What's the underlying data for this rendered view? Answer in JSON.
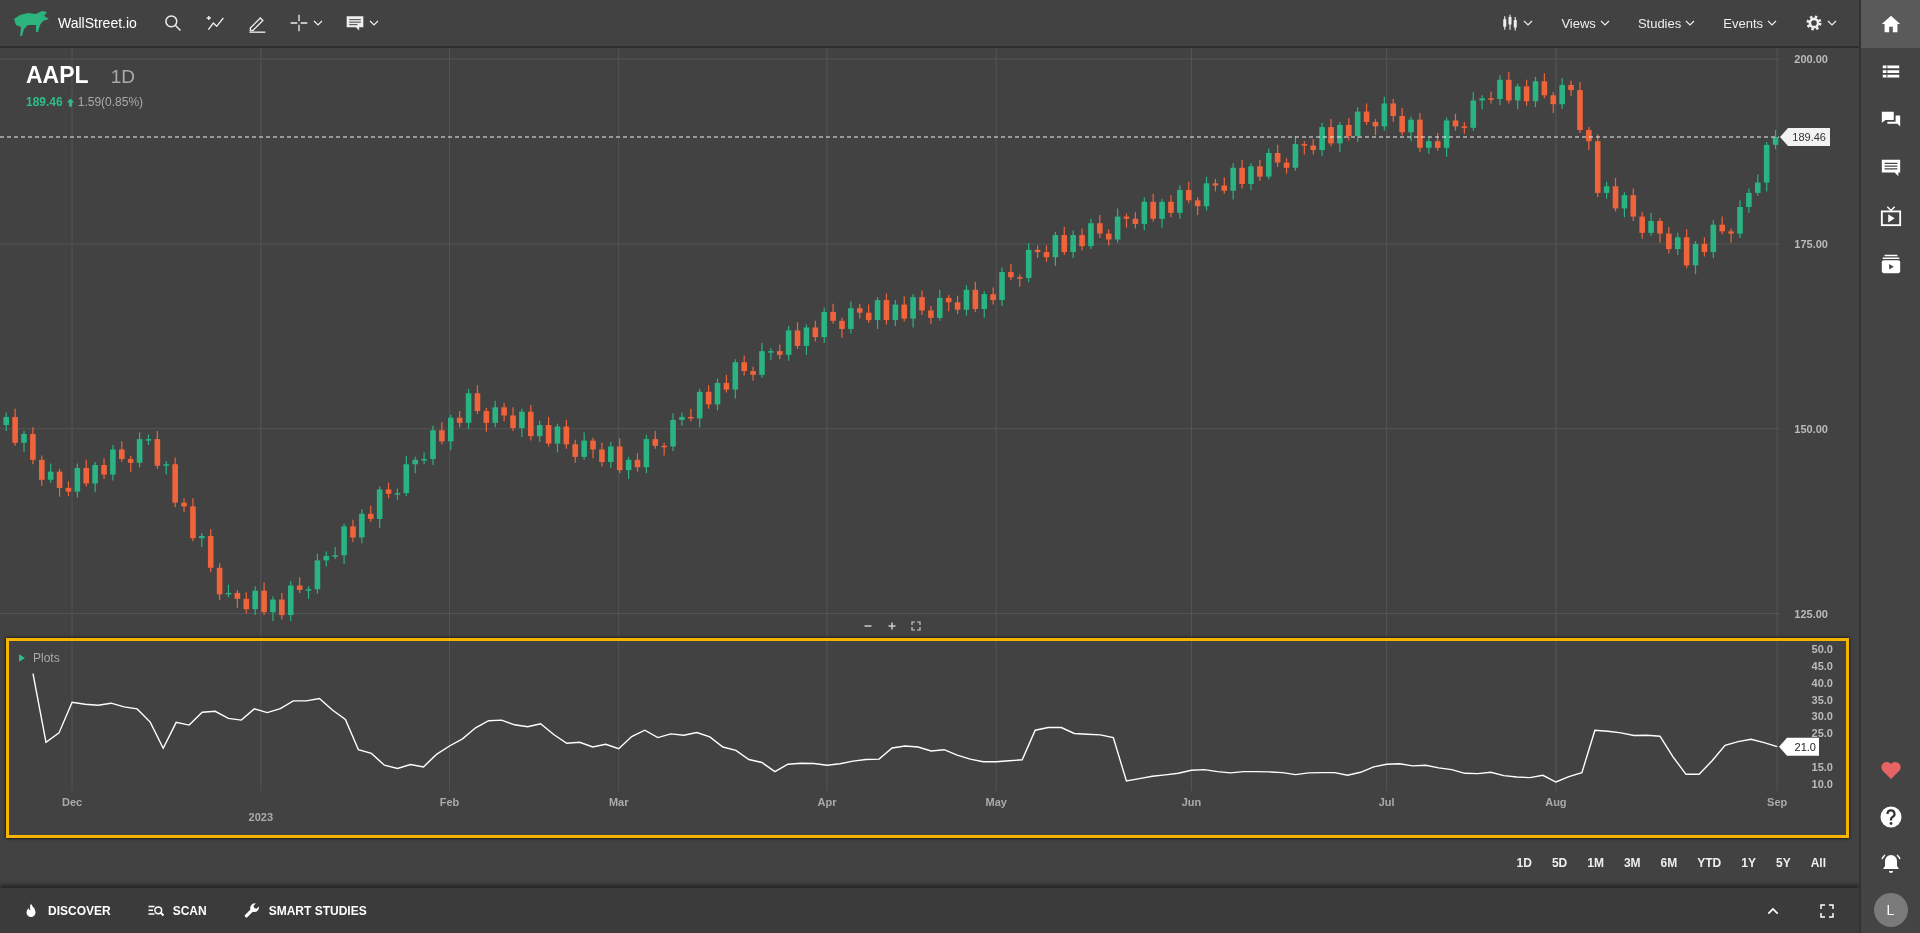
{
  "toolbar": {
    "brand": "WallStreet.io",
    "tools": [
      {
        "kind": "search",
        "menu": false
      },
      {
        "kind": "trend",
        "menu": false
      },
      {
        "kind": "draw",
        "menu": false
      },
      {
        "kind": "crosshair",
        "menu": true
      },
      {
        "kind": "comment",
        "menu": true
      }
    ],
    "right_items": [
      {
        "kind": "chart-type"
      },
      {
        "kind": "menu",
        "label": "Views"
      },
      {
        "kind": "menu",
        "label": "Studies"
      },
      {
        "kind": "menu",
        "label": "Events"
      },
      {
        "kind": "settings"
      }
    ]
  },
  "symbol": {
    "ticker": "AAPL",
    "interval": "1D",
    "price": "189.46",
    "change": "1.59(0.85%)"
  },
  "price_chart": {
    "last_price": "189.46",
    "chart_data": {
      "type": "candlestick",
      "grid": true,
      "ylim": [
        121.7,
        201.5
      ],
      "yticks": [
        {
          "value": 200,
          "label": "200.00"
        },
        {
          "value": 175,
          "label": "175.00"
        },
        {
          "value": 150,
          "label": "150.00"
        },
        {
          "value": 125,
          "label": "125.00"
        }
      ],
      "categories": [
        null,
        null,
        null,
        null,
        null,
        null,
        null,
        null,
        null,
        null,
        null,
        null,
        null,
        null,
        null,
        null,
        null,
        null,
        null,
        null,
        null,
        null,
        null,
        null,
        null,
        null,
        null,
        null,
        null,
        null,
        null,
        null,
        null,
        null,
        null,
        null,
        null,
        null,
        null,
        null,
        null,
        null,
        null,
        null,
        null,
        null,
        null,
        null,
        null,
        null,
        null,
        null,
        null,
        null,
        null,
        null,
        null,
        null,
        null,
        null,
        null,
        null,
        null,
        null,
        null,
        null,
        null,
        null,
        null,
        null,
        null,
        null,
        null,
        null,
        null,
        null,
        null,
        null,
        null,
        null,
        null,
        null,
        null,
        null,
        null,
        null,
        null,
        null,
        null,
        null,
        null,
        null,
        null,
        null,
        null,
        null,
        null,
        null,
        null,
        null,
        null,
        null,
        null,
        null,
        null,
        null,
        null,
        null,
        null,
        null,
        null,
        null,
        null,
        null,
        null,
        null,
        null,
        null,
        null,
        null,
        null,
        null,
        null,
        null,
        null,
        null,
        null,
        null,
        null,
        null,
        null,
        null,
        null,
        null,
        null,
        null,
        null,
        null,
        null,
        null,
        null,
        null,
        null,
        null,
        null,
        null,
        null,
        null,
        null,
        null,
        null,
        null,
        null,
        null,
        null,
        null,
        null,
        null,
        null,
        null,
        null,
        null,
        null,
        null,
        null,
        null,
        null,
        null,
        null,
        null,
        null,
        null,
        null,
        null,
        null,
        null,
        null,
        null,
        null,
        null,
        null,
        null,
        null,
        null,
        null,
        null,
        null,
        null,
        null,
        null,
        null,
        null,
        null,
        null,
        null,
        null,
        null,
        null,
        null,
        null
      ],
      "ohlc": [
        [
          150.5,
          152.2,
          149.7,
          151.6
        ],
        [
          151.6,
          152.7,
          147.7,
          148.1
        ],
        [
          148.1,
          149.7,
          146.9,
          149.3
        ],
        [
          149.3,
          150.2,
          145.2,
          145.8
        ],
        [
          145.8,
          146.4,
          142.3,
          143.1
        ],
        [
          143.1,
          145.3,
          142.7,
          144.2
        ],
        [
          144.2,
          144.6,
          140.8,
          142.0
        ],
        [
          142.0,
          142.9,
          140.9,
          141.5
        ],
        [
          141.5,
          145.3,
          140.7,
          144.7
        ],
        [
          144.7,
          145.8,
          142.2,
          142.6
        ],
        [
          142.6,
          145.5,
          141.4,
          145.1
        ],
        [
          145.1,
          146.0,
          143.2,
          143.8
        ],
        [
          143.8,
          147.8,
          143.0,
          147.2
        ],
        [
          147.2,
          148.3,
          145.5,
          145.9
        ],
        [
          145.9,
          146.3,
          144.2,
          145.4
        ],
        [
          145.4,
          149.5,
          144.8,
          148.6
        ],
        [
          148.6,
          149.2,
          147.8,
          148.6
        ],
        [
          148.6,
          149.7,
          144.6,
          145.0
        ],
        [
          145.0,
          145.6,
          143.8,
          145.2
        ],
        [
          145.2,
          146.1,
          139.4,
          140.0
        ],
        [
          140.0,
          140.6,
          138.7,
          139.5
        ],
        [
          139.5,
          140.6,
          134.8,
          135.2
        ],
        [
          135.2,
          135.9,
          134.0,
          135.5
        ],
        [
          135.5,
          136.4,
          130.6,
          131.2
        ],
        [
          131.2,
          131.8,
          126.8,
          127.6
        ],
        [
          127.6,
          128.9,
          127.2,
          127.8
        ],
        [
          127.8,
          128.2,
          125.8,
          127.0
        ],
        [
          127.0,
          127.9,
          125.0,
          125.6
        ],
        [
          125.6,
          128.7,
          124.8,
          128.1
        ],
        [
          128.1,
          129.2,
          124.8,
          125.2
        ],
        [
          125.2,
          127.3,
          124.0,
          126.9
        ],
        [
          126.9,
          127.8,
          124.2,
          124.8
        ],
        [
          124.8,
          129.4,
          124.0,
          128.8
        ],
        [
          128.8,
          129.9,
          127.8,
          128.2
        ],
        [
          128.2,
          128.7,
          127.0,
          128.3
        ],
        [
          128.3,
          133.1,
          127.7,
          132.2
        ],
        [
          132.2,
          133.4,
          131.4,
          132.8
        ],
        [
          132.8,
          134.0,
          132.4,
          132.9
        ],
        [
          132.9,
          137.2,
          131.7,
          136.8
        ],
        [
          136.8,
          137.7,
          134.7,
          135.3
        ],
        [
          135.3,
          139.1,
          134.5,
          138.5
        ],
        [
          138.5,
          139.6,
          137.4,
          137.8
        ],
        [
          137.8,
          142.2,
          136.6,
          141.8
        ],
        [
          141.8,
          142.7,
          140.6,
          141.2
        ],
        [
          141.2,
          141.9,
          140.4,
          141.3
        ],
        [
          141.3,
          146.3,
          140.9,
          145.2
        ],
        [
          145.2,
          146.2,
          144.0,
          145.8
        ],
        [
          145.8,
          146.8,
          145.2,
          145.9
        ],
        [
          145.9,
          150.4,
          145.1,
          149.8
        ],
        [
          149.8,
          150.9,
          147.9,
          148.3
        ],
        [
          148.3,
          151.9,
          147.1,
          151.5
        ],
        [
          151.5,
          152.4,
          150.2,
          150.8
        ],
        [
          150.8,
          155.4,
          150.0,
          154.8
        ],
        [
          154.8,
          155.9,
          152.0,
          152.4
        ],
        [
          152.4,
          152.8,
          149.6,
          150.8
        ],
        [
          150.8,
          153.8,
          150.2,
          152.9
        ],
        [
          152.9,
          153.5,
          151.0,
          151.8
        ],
        [
          151.8,
          152.9,
          149.7,
          150.1
        ],
        [
          150.1,
          152.7,
          148.9,
          152.3
        ],
        [
          152.3,
          153.2,
          148.4,
          149.0
        ],
        [
          149.0,
          151.1,
          148.2,
          150.5
        ],
        [
          150.5,
          151.6,
          147.6,
          148.0
        ],
        [
          148.0,
          150.7,
          146.8,
          150.3
        ],
        [
          150.3,
          151.2,
          147.3,
          147.9
        ],
        [
          147.9,
          148.5,
          145.4,
          146.2
        ],
        [
          146.2,
          149.5,
          145.8,
          148.4
        ],
        [
          148.4,
          148.8,
          146.0,
          147.2
        ],
        [
          147.2,
          148.1,
          144.9,
          145.5
        ],
        [
          145.5,
          148.2,
          144.7,
          147.6
        ],
        [
          147.6,
          148.7,
          144.0,
          144.4
        ],
        [
          144.4,
          146.2,
          143.2,
          145.8
        ],
        [
          145.8,
          146.7,
          144.2,
          144.8
        ],
        [
          144.8,
          149.2,
          144.0,
          148.6
        ],
        [
          148.6,
          149.7,
          147.3,
          147.7
        ],
        [
          147.7,
          148.1,
          146.4,
          147.6
        ],
        [
          147.6,
          152.1,
          147.0,
          151.2
        ],
        [
          151.2,
          152.2,
          150.4,
          151.6
        ],
        [
          151.6,
          152.7,
          151.0,
          151.4
        ],
        [
          151.4,
          155.4,
          150.2,
          155.0
        ],
        [
          155.0,
          155.9,
          152.7,
          153.3
        ],
        [
          153.3,
          156.8,
          152.5,
          156.2
        ],
        [
          156.2,
          157.3,
          154.9,
          155.3
        ],
        [
          155.3,
          159.4,
          154.1,
          159.0
        ],
        [
          159.0,
          159.9,
          157.2,
          157.8
        ],
        [
          157.8,
          158.4,
          156.5,
          157.3
        ],
        [
          157.3,
          161.6,
          156.9,
          160.5
        ],
        [
          160.5,
          160.9,
          159.3,
          160.5
        ],
        [
          160.5,
          161.4,
          159.4,
          160.0
        ],
        [
          160.0,
          163.9,
          159.2,
          163.3
        ],
        [
          163.3,
          164.4,
          160.8,
          161.2
        ],
        [
          161.2,
          164.1,
          160.0,
          163.7
        ],
        [
          163.7,
          164.6,
          161.8,
          162.4
        ],
        [
          162.4,
          166.4,
          161.6,
          165.8
        ],
        [
          165.8,
          166.9,
          164.2,
          164.6
        ],
        [
          164.6,
          165.0,
          162.3,
          163.5
        ],
        [
          163.5,
          167.2,
          162.9,
          166.3
        ],
        [
          166.3,
          166.9,
          164.9,
          165.7
        ],
        [
          165.7,
          166.8,
          164.3,
          164.7
        ],
        [
          164.7,
          167.8,
          163.5,
          167.4
        ],
        [
          167.4,
          168.3,
          164.1,
          164.7
        ],
        [
          164.7,
          167.4,
          163.9,
          166.8
        ],
        [
          166.8,
          167.9,
          164.5,
          164.9
        ],
        [
          164.9,
          168.2,
          163.7,
          167.8
        ],
        [
          167.8,
          168.7,
          165.4,
          166.0
        ],
        [
          166.0,
          166.6,
          164.2,
          165.0
        ],
        [
          165.0,
          168.8,
          164.6,
          167.7
        ],
        [
          167.7,
          168.1,
          165.9,
          167.1
        ],
        [
          167.1,
          168.0,
          165.5,
          166.1
        ],
        [
          166.1,
          169.4,
          165.3,
          168.8
        ],
        [
          168.8,
          169.9,
          165.8,
          166.2
        ],
        [
          166.2,
          168.6,
          165.0,
          168.2
        ],
        [
          168.2,
          169.1,
          166.8,
          167.4
        ],
        [
          167.4,
          171.8,
          166.6,
          171.2
        ],
        [
          171.2,
          172.3,
          170.1,
          170.5
        ],
        [
          170.5,
          170.9,
          169.2,
          170.4
        ],
        [
          170.4,
          175.1,
          169.8,
          174.2
        ],
        [
          174.2,
          174.8,
          173.1,
          173.9
        ],
        [
          173.9,
          174.8,
          172.6,
          173.2
        ],
        [
          173.2,
          176.6,
          172.0,
          176.2
        ],
        [
          176.2,
          177.3,
          173.5,
          173.9
        ],
        [
          173.9,
          176.8,
          173.1,
          176.2
        ],
        [
          176.2,
          177.1,
          174.1,
          174.7
        ],
        [
          174.7,
          178.4,
          174.3,
          177.8
        ],
        [
          177.8,
          178.9,
          175.8,
          176.4
        ],
        [
          176.4,
          177.0,
          174.8,
          175.6
        ],
        [
          175.6,
          179.8,
          175.2,
          178.7
        ],
        [
          178.7,
          179.1,
          177.2,
          178.4
        ],
        [
          178.4,
          179.3,
          177.1,
          177.7
        ],
        [
          177.7,
          181.3,
          176.9,
          180.7
        ],
        [
          180.7,
          181.8,
          178.0,
          178.4
        ],
        [
          178.4,
          181.1,
          177.2,
          180.7
        ],
        [
          180.7,
          181.6,
          178.6,
          179.2
        ],
        [
          179.2,
          182.9,
          178.4,
          182.3
        ],
        [
          182.3,
          183.4,
          180.5,
          180.9
        ],
        [
          180.9,
          181.3,
          178.9,
          180.1
        ],
        [
          180.1,
          184.1,
          179.5,
          183.2
        ],
        [
          183.2,
          183.8,
          182.1,
          182.9
        ],
        [
          182.9,
          184.0,
          181.8,
          182.2
        ],
        [
          182.2,
          185.9,
          181.0,
          185.3
        ],
        [
          185.3,
          186.4,
          182.5,
          183.1
        ],
        [
          183.1,
          185.9,
          182.3,
          185.5
        ],
        [
          185.5,
          186.4,
          183.5,
          184.1
        ],
        [
          184.1,
          187.9,
          183.7,
          187.3
        ],
        [
          187.3,
          188.4,
          185.4,
          186.0
        ],
        [
          186.0,
          186.6,
          184.5,
          185.3
        ],
        [
          185.3,
          189.6,
          184.9,
          188.5
        ],
        [
          188.5,
          188.9,
          187.1,
          188.3
        ],
        [
          188.3,
          189.2,
          187.1,
          187.7
        ],
        [
          187.7,
          191.4,
          186.9,
          190.8
        ],
        [
          190.8,
          191.9,
          188.2,
          188.6
        ],
        [
          188.6,
          191.5,
          187.4,
          191.1
        ],
        [
          191.1,
          192.0,
          189.0,
          189.6
        ],
        [
          189.6,
          193.5,
          188.8,
          192.9
        ],
        [
          192.9,
          194.0,
          191.1,
          191.5
        ],
        [
          191.5,
          191.9,
          189.7,
          190.9
        ],
        [
          190.9,
          194.9,
          190.3,
          194.0
        ],
        [
          194.0,
          194.6,
          191.5,
          192.3
        ],
        [
          192.3,
          193.4,
          189.7,
          190.1
        ],
        [
          190.1,
          192.2,
          188.9,
          191.8
        ],
        [
          191.8,
          192.7,
          187.4,
          188.0
        ],
        [
          188.0,
          189.5,
          187.2,
          188.9
        ],
        [
          188.9,
          190.0,
          187.6,
          188.0
        ],
        [
          188.0,
          192.1,
          186.8,
          191.7
        ],
        [
          191.7,
          192.6,
          190.3,
          190.9
        ],
        [
          190.9,
          191.5,
          189.9,
          190.7
        ],
        [
          190.7,
          195.5,
          190.3,
          194.4
        ],
        [
          194.4,
          195.1,
          193.2,
          194.7
        ],
        [
          194.7,
          195.6,
          194.0,
          194.6
        ],
        [
          194.6,
          197.8,
          193.8,
          197.2
        ],
        [
          197.2,
          198.3,
          194.0,
          194.4
        ],
        [
          194.4,
          196.7,
          193.2,
          196.3
        ],
        [
          196.3,
          197.2,
          193.7,
          194.3
        ],
        [
          194.3,
          197.6,
          193.5,
          197.0
        ],
        [
          197.0,
          198.1,
          194.7,
          195.1
        ],
        [
          195.1,
          195.5,
          192.7,
          193.9
        ],
        [
          193.9,
          197.4,
          193.3,
          196.5
        ],
        [
          196.5,
          197.1,
          195.0,
          195.8
        ],
        [
          195.8,
          196.9,
          190.0,
          190.4
        ],
        [
          190.4,
          190.8,
          187.7,
          188.9
        ],
        [
          188.9,
          189.8,
          181.3,
          181.9
        ],
        [
          181.9,
          183.4,
          181.1,
          182.8
        ],
        [
          182.8,
          183.9,
          179.4,
          179.8
        ],
        [
          179.8,
          182.0,
          178.6,
          181.6
        ],
        [
          181.6,
          182.5,
          178.1,
          178.7
        ],
        [
          178.7,
          179.3,
          175.7,
          176.5
        ],
        [
          176.5,
          179.2,
          176.1,
          178.1
        ],
        [
          178.1,
          178.5,
          175.2,
          176.4
        ],
        [
          176.4,
          177.3,
          173.7,
          174.3
        ],
        [
          174.3,
          176.5,
          173.5,
          175.9
        ],
        [
          175.9,
          177.0,
          171.7,
          172.1
        ],
        [
          172.1,
          175.4,
          170.9,
          175.0
        ],
        [
          175.0,
          175.9,
          173.3,
          173.9
        ],
        [
          173.9,
          178.2,
          173.1,
          177.6
        ],
        [
          177.6,
          178.7,
          176.3,
          176.7
        ],
        [
          176.7,
          177.1,
          175.2,
          176.4
        ],
        [
          176.4,
          180.9,
          175.8,
          180.0
        ],
        [
          180.0,
          182.5,
          179.2,
          181.9
        ],
        [
          181.9,
          184.4,
          181.5,
          183.3
        ],
        [
          183.3,
          188.8,
          182.1,
          188.4
        ],
        [
          188.4,
          190.4,
          187.8,
          189.46
        ]
      ]
    }
  },
  "zoom_controls": [
    {
      "kind": "zoom-out"
    },
    {
      "kind": "zoom-in"
    },
    {
      "kind": "fit"
    }
  ],
  "indicator": {
    "last_value": "21.0",
    "year_marker": {
      "label": "2023"
    },
    "chart_data": {
      "type": "line",
      "grid": true,
      "ylim": [
        10,
        50
      ],
      "categories": [
        null,
        null,
        null,
        "Dec",
        null,
        null,
        null,
        null,
        null,
        null,
        null,
        null,
        null,
        null,
        null,
        null,
        null,
        null,
        null,
        null,
        null,
        null,
        null,
        null,
        null,
        null,
        null,
        null,
        null,
        null,
        null,
        null,
        "Feb",
        null,
        null,
        null,
        null,
        null,
        null,
        null,
        null,
        null,
        null,
        null,
        null,
        "Mar",
        null,
        null,
        null,
        null,
        null,
        null,
        null,
        null,
        null,
        null,
        null,
        null,
        null,
        null,
        null,
        "Apr",
        null,
        null,
        null,
        null,
        null,
        null,
        null,
        null,
        null,
        null,
        null,
        null,
        "May",
        null,
        null,
        null,
        null,
        null,
        null,
        null,
        null,
        null,
        null,
        null,
        null,
        null,
        null,
        "Jun",
        null,
        null,
        null,
        null,
        null,
        null,
        null,
        null,
        null,
        null,
        null,
        null,
        null,
        null,
        "Jul",
        null,
        null,
        null,
        null,
        null,
        null,
        null,
        null,
        null,
        null,
        null,
        null,
        "Aug",
        null,
        null,
        null,
        null,
        null,
        null,
        null,
        null,
        null,
        null,
        null,
        null,
        null,
        null,
        null,
        null,
        "Sep"
      ],
      "yticks": [
        {
          "value": 50,
          "label": "50.0"
        },
        {
          "value": 45,
          "label": "45.0"
        },
        {
          "value": 40,
          "label": "40.0"
        },
        {
          "value": 35,
          "label": "35.0"
        },
        {
          "value": 30,
          "label": "30.0"
        },
        {
          "value": 25,
          "label": "25.0"
        },
        {
          "value": 15,
          "label": "15.0"
        },
        {
          "value": 10,
          "label": "10.0"
        }
      ],
      "series": [
        {
          "name": "Plots",
          "color": "#ffffff",
          "values": [
            42.7,
            22.3,
            25.1,
            34.2,
            33.6,
            33.3,
            33.9,
            32.8,
            32.2,
            28.3,
            20.5,
            28.2,
            27.4,
            31.2,
            31.5,
            29.4,
            28.9,
            32.2,
            31.1,
            32.3,
            34.6,
            34.6,
            35.3,
            31.9,
            29.1,
            20.1,
            19.0,
            15.5,
            14.5,
            15.7,
            15.0,
            18.7,
            21.2,
            23.3,
            26.6,
            28.7,
            28.9,
            27.5,
            26.9,
            27.8,
            24.6,
            22.0,
            22.3,
            20.9,
            21.7,
            20.4,
            24.0,
            25.9,
            23.7,
            24.8,
            24.4,
            25.2,
            23.9,
            20.9,
            19.9,
            17.2,
            16.3,
            13.6,
            15.8,
            16.1,
            16.0,
            15.5,
            15.9,
            16.7,
            17.2,
            17.3,
            20.6,
            21.2,
            20.9,
            19.7,
            20.1,
            18.5,
            17.3,
            16.5,
            16.5,
            16.8,
            17.1,
            25.9,
            26.7,
            26.7,
            24.9,
            24.7,
            24.5,
            23.7,
            10.8,
            11.5,
            12.2,
            12.6,
            13.1,
            14.0,
            14.2,
            13.6,
            13.2,
            13.6,
            13.6,
            13.5,
            13.3,
            12.7,
            13.2,
            13.3,
            13.3,
            12.5,
            13.4,
            15.0,
            15.8,
            15.9,
            15.3,
            15.5,
            14.7,
            14.2,
            13.1,
            13.0,
            13.4,
            12.4,
            12.0,
            11.8,
            12.5,
            10.5,
            12.1,
            13.3,
            25.9,
            25.6,
            25.1,
            24.3,
            24.4,
            24.1,
            18.0,
            12.8,
            12.8,
            16.8,
            21.4,
            22.5,
            23.2,
            22.2,
            21.0
          ]
        }
      ]
    }
  },
  "ranges": [
    "1D",
    "5D",
    "1M",
    "3M",
    "6M",
    "YTD",
    "1Y",
    "5Y",
    "All"
  ],
  "bottom_bar": {
    "items": [
      {
        "kind": "discover",
        "label": "DISCOVER"
      },
      {
        "kind": "scan",
        "label": "SCAN"
      },
      {
        "kind": "studies",
        "label": "SMART STUDIES"
      }
    ],
    "controls": [
      {
        "kind": "collapse"
      },
      {
        "kind": "fullscreen"
      }
    ]
  },
  "sidebar": {
    "items": [
      {
        "kind": "home",
        "selected": true
      },
      {
        "kind": "watchlist",
        "selected": false
      },
      {
        "kind": "chat",
        "selected": false
      },
      {
        "kind": "message",
        "selected": false
      },
      {
        "kind": "tv",
        "selected": false
      },
      {
        "kind": "playlist",
        "selected": false
      }
    ],
    "bottom": [
      {
        "kind": "favorite"
      },
      {
        "kind": "help"
      },
      {
        "kind": "alerts"
      }
    ],
    "avatar": "L"
  }
}
